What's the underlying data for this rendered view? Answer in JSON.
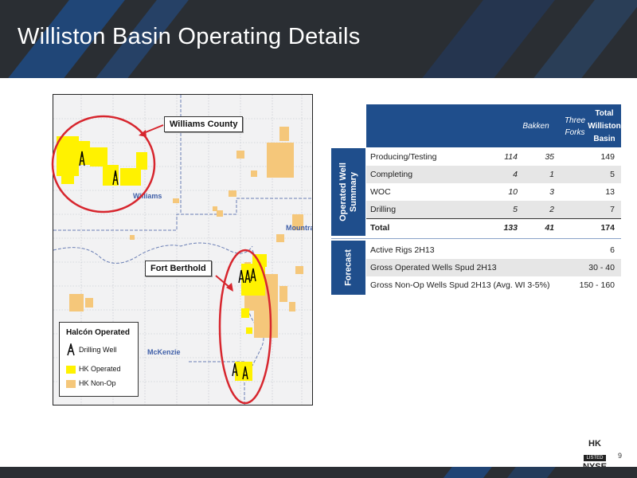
{
  "page": {
    "title": "Williston Basin Operating Details",
    "page_number": "9"
  },
  "map": {
    "callouts": {
      "williams_county": "Williams County",
      "fort_berthold": "Fort Berthold"
    },
    "place_labels": {
      "williams": "Williams",
      "mountrail": "Mountra",
      "mckenzie": "McKenzie"
    },
    "legend": {
      "title": "Halcón Operated",
      "drilling_well": "Drilling Well",
      "hk_operated": "HK Operated",
      "hk_non_op": "HK Non-Op"
    },
    "colors": {
      "hk_operated": "#fff200",
      "hk_non_op": "#f5c77a",
      "highlight_circle": "#d7262e"
    }
  },
  "table": {
    "headers": {
      "bakken": "Bakken",
      "three_forks_line1": "Three",
      "three_forks_line2": "Forks",
      "total_line1": "Total",
      "total_line2": "Williston",
      "total_line3": "Basin"
    },
    "operated_section_label_line1": "Operated Well",
    "operated_section_label_line2": "Summary",
    "operated_rows": [
      {
        "label": "Producing/Testing",
        "bakken": "114",
        "three_forks": "35",
        "total": "149"
      },
      {
        "label": "Completing",
        "bakken": "4",
        "three_forks": "1",
        "total": "5"
      },
      {
        "label": "WOC",
        "bakken": "10",
        "three_forks": "3",
        "total": "13"
      },
      {
        "label": "Drilling",
        "bakken": "5",
        "three_forks": "2",
        "total": "7"
      },
      {
        "label": "Total",
        "bakken": "133",
        "three_forks": "41",
        "total": "174"
      }
    ],
    "forecast_section_label": "Forecast",
    "forecast_rows": [
      {
        "label": "Active Rigs 2H13",
        "value": "6"
      },
      {
        "label": "Gross Operated Wells Spud 2H13",
        "value": "30 - 40"
      },
      {
        "label": "Gross Non-Op Wells Spud 2H13 (Avg. WI 3-5%)",
        "value": "150 - 160"
      }
    ],
    "colors": {
      "header_bg": "#1f4e8c",
      "alt_row_bg": "#e6e6e6"
    }
  },
  "logo": {
    "line1": "HK",
    "line2": "LISTED",
    "line3": "NYSE"
  }
}
